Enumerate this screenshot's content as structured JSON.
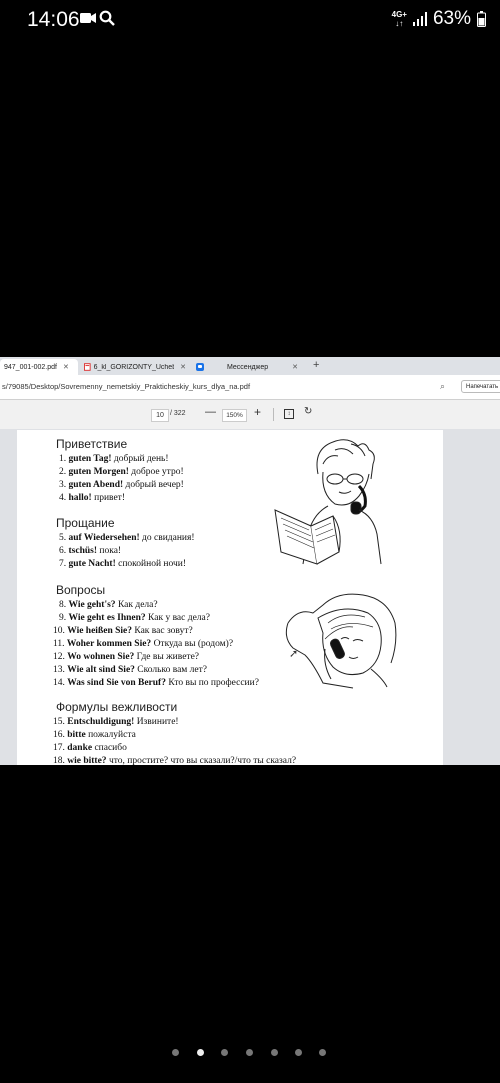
{
  "status": {
    "time": "14:06",
    "net_top": "4G+",
    "net_bottom": "↓↑",
    "battery": "63%"
  },
  "browser": {
    "tabs": [
      {
        "label": "947_001-002.pdf",
        "close": "✕"
      },
      {
        "label": "6_kl_GORIZONTY_Uchebni",
        "close": "✕"
      },
      {
        "label": "Мессенджер",
        "close": "✕"
      }
    ],
    "new_tab": "+",
    "url": "s/79085/Desktop/Sovremenny_nemetskiy_Prakticheskiy_kurs_dlya_na.pdf",
    "whatsapp_btn": "Напечатать"
  },
  "pdf_toolbar": {
    "page": "10",
    "total": "/ 322",
    "zoom_out": "—",
    "zoom": "150%",
    "zoom_in": "+"
  },
  "doc": {
    "h1": "Приветствие",
    "s1": [
      {
        "n": "1.",
        "de": "guten Tag!",
        "ru": "добрый день!"
      },
      {
        "n": "2.",
        "de": "guten Morgen!",
        "ru": "доброе утро!"
      },
      {
        "n": "3.",
        "de": "guten Abend!",
        "ru": "добрый вечер!"
      },
      {
        "n": "4.",
        "de": "hallo!",
        "ru": "привет!"
      }
    ],
    "h2": "Прощание",
    "s2": [
      {
        "n": "5.",
        "de": "auf Wiedersehen!",
        "ru": "до свидания!"
      },
      {
        "n": "6.",
        "de": "tschüs!",
        "ru": "пока!"
      },
      {
        "n": "7.",
        "de": "gute Nacht!",
        "ru": "спокойной ночи!"
      }
    ],
    "h3": "Вопросы",
    "s3": [
      {
        "n": "8.",
        "de": "Wie geht's?",
        "ru": "Как дела?"
      },
      {
        "n": "9.",
        "de": "Wie geht es Ihnen?",
        "ru": "Как у вас дела?"
      },
      {
        "n": "10.",
        "de": "Wie heißen Sie?",
        "ru": "Как вас зовут?"
      },
      {
        "n": "11.",
        "de": "Woher kommen Sie?",
        "ru": "Откуда вы (родом)?"
      },
      {
        "n": "12.",
        "de": "Wo wohnen Sie?",
        "ru": "Где вы живете?"
      },
      {
        "n": "13.",
        "de": "Wie alt sind Sie?",
        "ru": "Сколько вам лет?"
      },
      {
        "n": "14.",
        "de": "Was sind Sie von Beruf?",
        "ru": "Кто вы по профессии?"
      }
    ],
    "h4": "Формулы вежливости",
    "s4": [
      {
        "n": "15.",
        "de": "Entschuldigung!",
        "ru": "Извините!"
      },
      {
        "n": "16.",
        "de": "bitte",
        "ru": "пожалуйста"
      },
      {
        "n": "17.",
        "de": "danke",
        "ru": "спасибо"
      },
      {
        "n": "18.",
        "de": "wie bitte?",
        "ru": "что, простите? что вы сказали?/что ты сказал?"
      }
    ]
  }
}
